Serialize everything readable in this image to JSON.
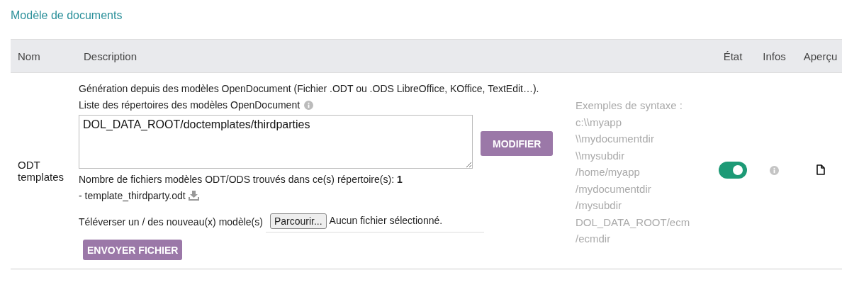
{
  "section_title": "Modèle de documents",
  "table": {
    "columns": [
      "Nom",
      "Description",
      "État",
      "Infos",
      "Aperçu"
    ],
    "rows": [
      {
        "name": "ODT templates",
        "description": "Génération depuis des modèles OpenDocument (Fichier .ODT ou .ODS LibreOffice, KOffice, TextEdit…).",
        "dir_label": "Liste des répertoires des modèles OpenDocument",
        "dir_value": "DOL_DATA_ROOT/doctemplates/thirdparties",
        "modify_button": "MODIFIER",
        "count_text": "Nombre de fichiers modèles ODT/ODS trouvés dans ce(s) répertoire(s): **1**",
        "files": [
          "- template_thirdparty.odt"
        ],
        "upload_label": "Téléverser un / des nouveau(x) modèle(s)",
        "browse_button": "Parcourir...",
        "no_file": "Aucun fichier sélectionné.",
        "send_button": "ENVOYER FICHIER",
        "syntax_title": "Exemples de syntaxe :",
        "syntax_examples": [
          "c:\\\\myapp",
          "\\\\mydocumentdir",
          "\\\\mysubdir",
          "/home/myapp",
          "/mydocumentdir",
          "/mysubdir",
          "DOL_DATA_ROOT/ecm",
          "/ecmdir"
        ],
        "enabled": true
      }
    ]
  }
}
